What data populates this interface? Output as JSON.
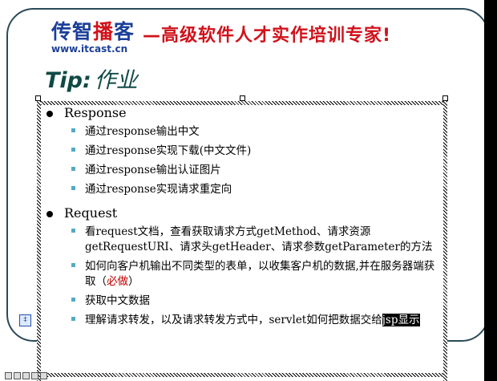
{
  "header": {
    "logo_prefix": "传智",
    "logo_highlight": "播",
    "logo_suffix": "客",
    "logo_url": "www.itcast.cn",
    "slogan": "—高级软件人才实作培训专家!"
  },
  "title": {
    "prefix": "Tip:",
    "text": "作业"
  },
  "sections": [
    {
      "heading": "Response",
      "items": [
        "通过response输出中文",
        "通过response实现下载(中文文件)",
        "通过response输出认证图片",
        "通过response实现请求重定向"
      ]
    },
    {
      "heading": "Request",
      "items": [
        "看request文档，查看获取请求方式getMethod、请求资源getRequestURI、请求头getHeader、请求参数getParameter的方法",
        "如何向客户机输出不同类型的表单，以收集客户机的数据,并在服务器端获取（",
        "获取中文数据",
        "理解请求转发，以及请求转发方式中，servlet如何把数据交给"
      ],
      "item2_highlight": "必做",
      "item2_tail": "）",
      "item4_selected": "jsp显示"
    }
  ],
  "colors": {
    "brand_blue": "#1b3f99",
    "brand_red": "#d0121b",
    "title_green": "#0f4a45",
    "bullet_blue": "#57a9c5"
  }
}
